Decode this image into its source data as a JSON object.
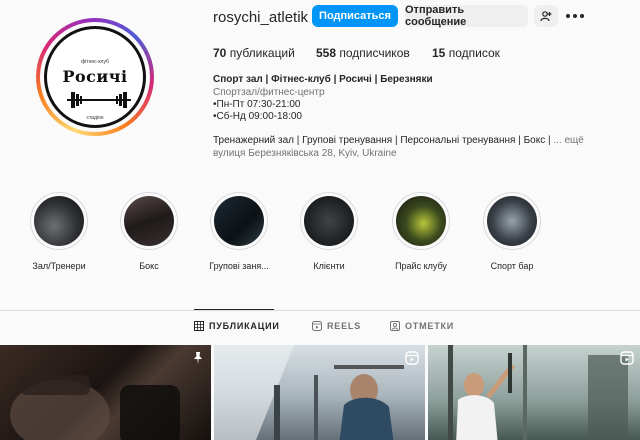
{
  "profile": {
    "username": "rosychi_atletik",
    "follow_label": "Подписаться",
    "message_label": "Отправить сообщение",
    "avatar_brand": "Росичі",
    "avatar_top_text": "фітнес-клуб",
    "avatar_bottom_text": "стадіон"
  },
  "stats": {
    "posts": {
      "count": "70",
      "label": "публикаций"
    },
    "followers": {
      "count": "558",
      "label": "подписчиков"
    },
    "following": {
      "count": "15",
      "label": "подписок"
    }
  },
  "bio": {
    "name": "Спорт зал | Фітнес-клуб | Росичі | Березняки",
    "category": "Спортзал/фитнес-центр",
    "line1": "•Пн-Пт 07:30-21:00",
    "line2": "•Сб-Нд 09:00-18:00",
    "description": "Тренажерний зал | Групові тренування | Персональні тренування | Бокс |",
    "more_label": "... ещё",
    "address": "вулиця Березняківська 28, Kyiv, Ukraine"
  },
  "highlights": [
    {
      "label": "Зал/Тренери"
    },
    {
      "label": "Бокс"
    },
    {
      "label": "Групові заня..."
    },
    {
      "label": "Клієнти"
    },
    {
      "label": "Прайс клубу"
    },
    {
      "label": "Спорт бар"
    }
  ],
  "tabs": {
    "posts": "ПУБЛИКАЦИИ",
    "reels": "REELS",
    "tagged": "ОТМЕТКИ"
  },
  "icons": {
    "add_user": "add-user-icon",
    "more": "more-icon",
    "grid": "grid-icon",
    "reels": "reels-icon",
    "tagged": "tagged-icon",
    "pin": "pin-icon"
  },
  "colors": {
    "accent": "#0095f6",
    "background": "#fafafa",
    "secondary_button": "#efefef",
    "muted_text": "#737373"
  }
}
